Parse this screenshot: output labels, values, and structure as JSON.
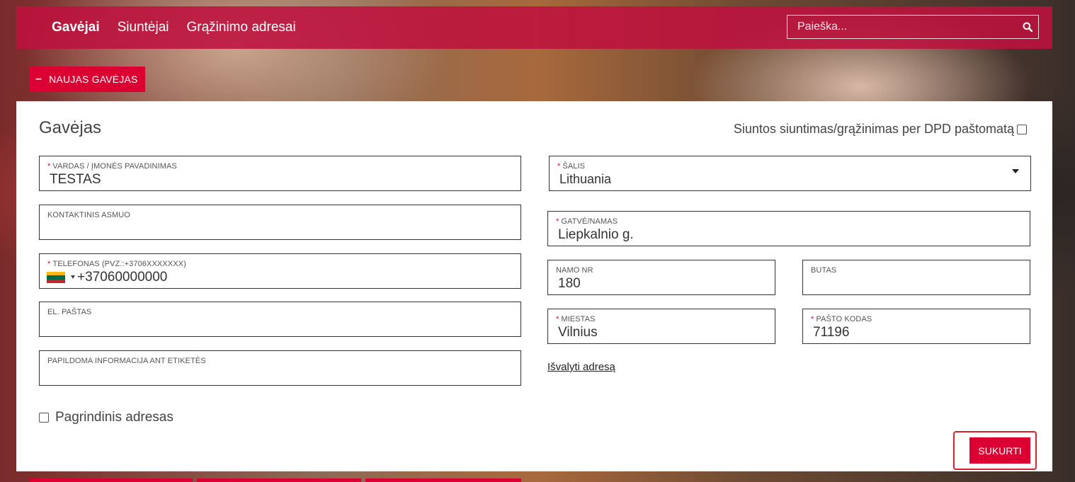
{
  "nav": {
    "items": [
      {
        "label": "Gavėjai",
        "active": true
      },
      {
        "label": "Siuntėjai",
        "active": false
      },
      {
        "label": "Grąžinimo adresai",
        "active": false
      }
    ]
  },
  "search": {
    "placeholder": "Paieška..."
  },
  "new_button": {
    "label": "NAUJAS GAVĖJAS",
    "icon": "minus"
  },
  "form": {
    "title": "Gavėjas",
    "locker_label": "Siuntos siuntimas/grąžinimas per DPD paštomatą",
    "fields": {
      "name": {
        "label": "VARDAS / ĮMONĖS PAVADINIMAS",
        "required": "*",
        "value": "TESTAS"
      },
      "contact": {
        "label": "KONTAKTINIS ASMUO",
        "value": ""
      },
      "phone": {
        "label": "TELEFONAS (PVZ.:+3706XXXXXXX)",
        "required": "*",
        "value": "+37060000000"
      },
      "email": {
        "label": "EL. PAŠTAS",
        "value": ""
      },
      "extra": {
        "label": "PAPILDOMA INFORMACIJA ANT ETIKETĖS",
        "value": ""
      },
      "country": {
        "label": "ŠALIS",
        "required": "*",
        "value": "Lithuania"
      },
      "street": {
        "label": "GATVĖ/NAMAS",
        "required": "*",
        "value": "Liepkalnio g."
      },
      "house": {
        "label": "NAMO NR",
        "value": "180"
      },
      "flat": {
        "label": "BUTAS",
        "value": ""
      },
      "city": {
        "label": "MIESTAS",
        "required": "*",
        "value": "Vilnius"
      },
      "postcode": {
        "label": "PAŠTO KODAS",
        "required": "*",
        "value": "71196"
      }
    },
    "clear_link": "Išvalyti adresą",
    "primary_label": "Pagrindinis adresas",
    "submit_label": "SUKURTI"
  },
  "colors": {
    "brand": "#dc0032",
    "topbar": "#be113e"
  }
}
